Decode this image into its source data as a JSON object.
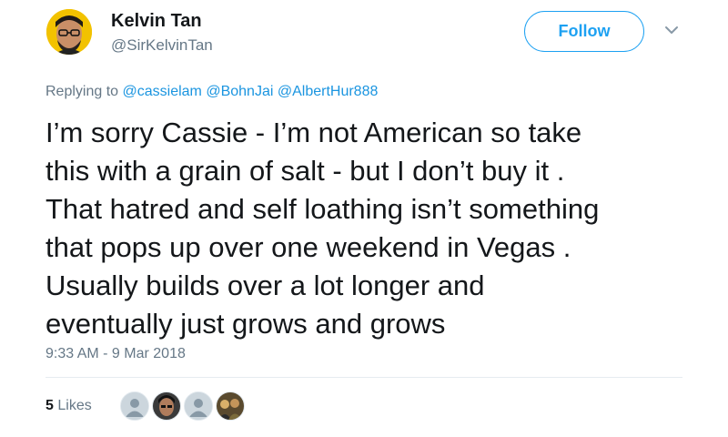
{
  "author": {
    "name": "Kelvin Tan",
    "handle": "@SirKelvinTan",
    "avatar_icon": "man-glasses-avatar",
    "avatar_bg": "#f2c200"
  },
  "actions": {
    "follow_label": "Follow",
    "menu_icon": "chevron-down-icon"
  },
  "reply_context": {
    "prefix": "Replying to",
    "mentions": [
      "@cassielam",
      "@BohnJai",
      "@AlbertHur888"
    ]
  },
  "tweet": {
    "lines": [
      "I’m sorry Cassie - I’m not American so take",
      "this with a grain of salt - but I don’t buy it .",
      "That hatred and self loathing isn’t something",
      "that pops up over one weekend in Vegas .",
      "Usually builds over a lot longer and",
      "eventually just grows and grows"
    ],
    "timestamp": "9:33 AM - 9 Mar 2018"
  },
  "engagement": {
    "likes_count": "5",
    "likes_label": "Likes",
    "likers": [
      {
        "icon": "default-egg-avatar"
      },
      {
        "icon": "person-photo-avatar"
      },
      {
        "icon": "default-egg-avatar"
      },
      {
        "icon": "group-photo-avatar"
      }
    ]
  },
  "colors": {
    "accent": "#1da1f2",
    "link": "#1b95e0",
    "secondary_text": "#657786",
    "divider": "#e6ecf0"
  }
}
